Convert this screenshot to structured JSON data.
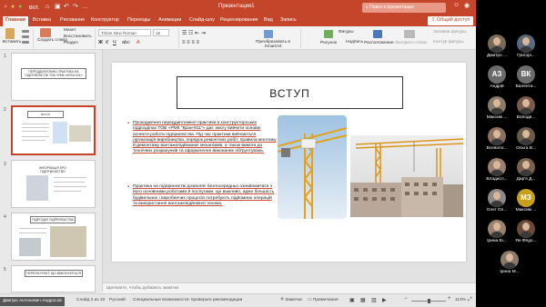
{
  "titlebar": {
    "autosave": "ВКЛ.",
    "document_title": "Презентация1",
    "search_placeholder": "Поиск в презентации"
  },
  "tabs": [
    "Главная",
    "Вставка",
    "Рисование",
    "Конструктор",
    "Переходы",
    "Анимации",
    "Слайд-шоу",
    "Рецензирование",
    "Вид",
    "Запись"
  ],
  "share_label": "Общий доступ",
  "ribbon": {
    "paste": "Вставить",
    "new_slide": "Создать слайд",
    "layout": "Макет",
    "reset": "Восстановить",
    "section": "Раздел",
    "font": "Times New Roman",
    "font_size": "16",
    "convert_smartart": "Преобразовать в SmartArt",
    "picture": "Рисунок",
    "shapes": "Фигуры",
    "textbox": "Надпись",
    "arrange": "Расположение",
    "quick_styles": "Экспресс-стили",
    "shape_fill": "Заливка фигуры",
    "shape_outline": "Контур фигуры"
  },
  "thumbnails": [
    {
      "num": "1",
      "title": "ПЕРЕДДИПЛОМНА ПРАКТИКА НА ПІДПРИЄМСТВІ ТОВ «РМК «КРАН-911»"
    },
    {
      "num": "2",
      "title": "ВСТУП"
    },
    {
      "num": "3",
      "title": "ІНФОРМАЦІЯ ПРО ПІДПРИЄМСТВО"
    },
    {
      "num": "4",
      "title": "ПІДРОЗДІЛ ПІДПРИЄМСТВА"
    },
    {
      "num": "5",
      "title": "ПЕРЕЛІК РОБІТ, ЩО ВИКОНУЮТЬСЯ"
    }
  ],
  "slide": {
    "title": "ВСТУП",
    "bullets": [
      "Проходження переддипломної практики в конструкторських підрозділах ТОВ «РМК \"Кран-911\"» дає змогу вивчити основні аспекти роботи підприємства. Під час практики вивчаються організація виробництва, порядок ремонтних робіт, правила монтажу й демонтажу вантажопідйомних механізмів, а також вимоги до технічних розрахунків та оформлення виконаних обґрунтувань.",
      "Практика на підприємстві дозволяє безпосередньо ознайомитися з його основними роботами й послугами. Це важливо, адже більшість будівельних і виробничих процесів потребують підйомних операцій та використання вантажопідйомної техніки."
    ]
  },
  "notes_placeholder": "Щелкните, чтобы добавить заметки",
  "status": {
    "user": "Дмитро Антонович Андросов",
    "slide_info": "Слайд 2 из 10",
    "language": "Русский",
    "accessibility": "Специальные возможности: проверьте рекомендации",
    "notes": "Заметки",
    "comments": "Примечания",
    "zoom": "113%"
  },
  "participants": [
    {
      "name": "Дмитро ...",
      "initials": "",
      "color": "#7a6a5a"
    },
    {
      "name": "Григорі...",
      "initials": "",
      "color": "#5a6a7a"
    },
    {
      "name": "Андрій",
      "initials": "АЗ",
      "color": "#6b6b6b"
    },
    {
      "name": "Валенти...",
      "initials": "ВК",
      "color": "#6b6b6b"
    },
    {
      "name": "Максим ...",
      "initials": "",
      "color": "#8a7a6a"
    },
    {
      "name": "Володи...",
      "initials": "",
      "color": "#7a5a4a"
    },
    {
      "name": "Всеволо...",
      "initials": "",
      "color": "#8a7060"
    },
    {
      "name": "Ольга В...",
      "initials": "",
      "color": "#6a5a4a"
    },
    {
      "name": "Владисл...",
      "initials": "",
      "color": "#9a8070"
    },
    {
      "name": "Дар'я Д...",
      "initials": "",
      "color": "#7a6050"
    },
    {
      "name": "Олег Ол...",
      "initials": "",
      "color": "#8a8a8a"
    },
    {
      "name": "Максим ...",
      "initials": "МЗ",
      "color": "#c7a01a"
    },
    {
      "name": "Ірина Ві...",
      "initials": "",
      "color": "#9a8070"
    },
    {
      "name": "Ян Фёдо...",
      "initials": "",
      "color": "#6a4a3a"
    },
    {
      "name": "Ірина М...",
      "initials": "",
      "color": "#8a7a6a"
    }
  ]
}
